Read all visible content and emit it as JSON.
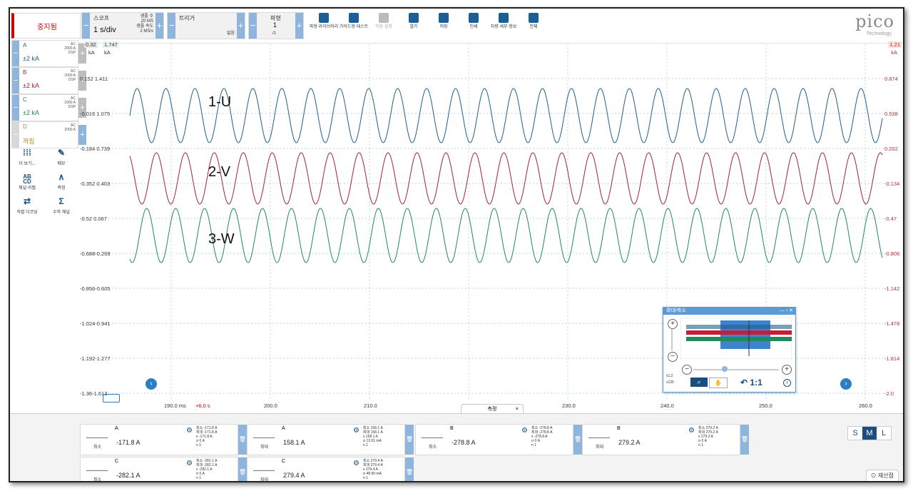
{
  "toolbar": {
    "stop_label": "중지됨",
    "scope_label": "스코프",
    "timebase": "1 s/div",
    "samples_label": "샘플 수",
    "samples_value": "20 MS",
    "rate_label": "샘플 속도",
    "rate_value": "2 MS/s",
    "trigger_label": "트리거",
    "trigger_value": "없음",
    "waveform_label": "파형",
    "waveform_value": "1",
    "waveform_total": "/1",
    "tools": [
      {
        "label": "파형 라이브러리",
        "icon": "library-icon"
      },
      {
        "label": "가이드형 테스트",
        "icon": "car-icon"
      },
      {
        "label": "자동 설정",
        "icon": "wand-icon"
      },
      {
        "label": "열기",
        "icon": "folder-icon"
      },
      {
        "label": "저장",
        "icon": "save-icon"
      },
      {
        "label": "인쇄",
        "icon": "print-icon"
      },
      {
        "label": "차량 세부 정보",
        "icon": "clipboard-icon"
      },
      {
        "label": "전체",
        "icon": "fullscreen-icon"
      }
    ],
    "logo": "pico",
    "logo_sub": "Technology"
  },
  "channels": [
    {
      "name": "A",
      "range": "±2 kA",
      "coupling": "AC\n2000 A\nDSP",
      "color": "#1f5f8b"
    },
    {
      "name": "B",
      "range": "±2 kA",
      "coupling": "AC\n2000 A\nDSP",
      "color": "#a3213e"
    },
    {
      "name": "C",
      "range": "±2 kA",
      "coupling": "AC\n2000 A\nDSP",
      "color": "#1f8a5a"
    },
    {
      "name": "D",
      "range": "꺼짐",
      "coupling": "AC\n2000 A",
      "color": "#b08a20"
    }
  ],
  "side_tools": [
    {
      "label": "더 보기...",
      "icon": "grid-icon"
    },
    {
      "label": "메모",
      "icon": "note-icon"
    },
    {
      "label": "채널 라벨",
      "icon": "abcd-icon"
    },
    {
      "label": "측정",
      "icon": "compass-icon"
    },
    {
      "label": "직렬 디코딩",
      "icon": "decode-icon"
    },
    {
      "label": "수학 채널",
      "icon": "sigma-icon"
    }
  ],
  "plot": {
    "left_top_a": "0.32",
    "left_top_b": "1.747",
    "left_unit_a": "kA",
    "left_unit_b": "kA",
    "right_top": "1.21",
    "right_unit": "kA",
    "left_ticks": [
      "0.152 1.411",
      "-0.016 1.075",
      "-0.184 0.739",
      "-0.352 0.403",
      "-0.52 0.067",
      "-0.688-0.269",
      "-0.856-0.605",
      "-1.024-0.941",
      "-1.192-1.277",
      "-1.36-1.613"
    ],
    "right_ticks": [
      "0.874",
      "0.538",
      "0.202",
      "-0.134",
      "-0.47",
      "-0.806",
      "-1.142",
      "-1.478",
      "-1.814",
      "-2.0"
    ],
    "x_ticks": [
      "190.0 ms",
      "200.0",
      "210.0",
      "220.0",
      "230.0",
      "240.0",
      "250.0",
      "260.0"
    ],
    "x_marker": "+6.0 s",
    "wave_labels": [
      "1-U",
      "2-V",
      "3-W"
    ]
  },
  "zoom": {
    "title": "확대/축소",
    "ratio": "1:1",
    "x_zoom": "x1.2",
    "y_zoom": "x126"
  },
  "measurements": {
    "tab_label": "측정",
    "cards": [
      {
        "channel": "A",
        "kind": "최소",
        "value": "-171.8 A",
        "stats": [
          "최소 -171.8 A",
          "최대 -171.8 A",
          "x    -171.8 A",
          "σ    0 A",
          "n    1"
        ]
      },
      {
        "channel": "A",
        "kind": "최대",
        "value": "158.1 A",
        "stats": [
          "최소 158.1 A",
          "최대 158.1 A",
          "x    158.1 A",
          "σ    13.91 mA",
          "n    1"
        ]
      },
      {
        "channel": "B",
        "kind": "최소",
        "value": "-278.8 A",
        "stats": [
          "최소 -278.8 A",
          "최대 -278.8 A",
          "x    -278.8 A",
          "σ    0 A",
          "n    1"
        ]
      },
      {
        "channel": "B",
        "kind": "최대",
        "value": "279.2 A",
        "stats": [
          "최소 279.2 A",
          "최대 279.2 A",
          "x    279.2 A",
          "σ    0 A",
          "n    1"
        ]
      },
      {
        "channel": "C",
        "kind": "최소",
        "value": "-282.1 A",
        "stats": [
          "최소 -282.1 A",
          "최대 -282.1 A",
          "x    -282.1 A",
          "σ    0 A",
          "n    1"
        ]
      },
      {
        "channel": "C",
        "kind": "최대",
        "value": "279.4 A",
        "stats": [
          "최소 279.4 A",
          "최대 279.4 A",
          "x    279.4 A",
          "σ    48.90 mA",
          "n    1"
        ]
      }
    ],
    "size_buttons": [
      "S",
      "M",
      "L"
    ],
    "properties_label": "재산점"
  },
  "colors": {
    "accent": "#1a4f7d",
    "stop": "#cc0000",
    "wave_a": "#1f5f8b",
    "wave_b": "#a3213e",
    "wave_c": "#1f8a5a"
  }
}
